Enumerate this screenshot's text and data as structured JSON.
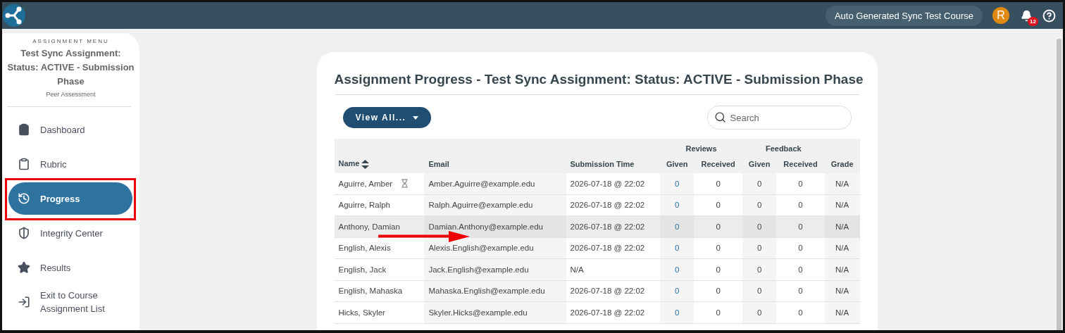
{
  "top_bar": {
    "course": "Auto Generated Sync Test Course",
    "avatar": "R",
    "notifications": "12"
  },
  "sidebar": {
    "caption": "ASSIGNMENT MENU",
    "title": "Test Sync Assignment: Status: ACTIVE - Submission Phase",
    "subtitle": "Peer Assessment",
    "items": [
      {
        "kind": "dashboard",
        "label": "Dashboard",
        "selected": false,
        "outlined": false
      },
      {
        "kind": "rubric",
        "label": "Rubric",
        "selected": false,
        "outlined": false
      },
      {
        "kind": "progress",
        "label": "Progress",
        "selected": true,
        "outlined": true
      },
      {
        "kind": "integrity",
        "label": "Integrity Center",
        "selected": false,
        "outlined": false
      },
      {
        "kind": "results",
        "label": "Results",
        "selected": false,
        "outlined": false
      },
      {
        "kind": "exit",
        "label": "Exit to Course Assignment List",
        "selected": false,
        "outlined": false
      }
    ]
  },
  "card": {
    "title": "Assignment Progress - Test Sync Assignment: Status: ACTIVE - Submission Phase",
    "view_button": "View All...",
    "search": {
      "placeholder": "Search"
    },
    "table": {
      "groups": [
        "Reviews",
        "Feedback"
      ],
      "columns": [
        "Name",
        "Email",
        "Submission Time",
        "Given",
        "Received",
        "Given",
        "Received",
        "Grade"
      ],
      "rows": [
        {
          "pending": true,
          "highlighted": false,
          "pointed": false,
          "cells": [
            "Aguirre, Amber",
            "Amber.Aguirre@example.edu",
            "2026-07-18 @ 22:02",
            "0",
            "0",
            "0",
            "0",
            "N/A"
          ]
        },
        {
          "pending": false,
          "highlighted": false,
          "pointed": false,
          "cells": [
            "Aguirre, Ralph",
            "Ralph.Aguirre@example.edu",
            "2026-07-18 @ 22:02",
            "0",
            "0",
            "0",
            "0",
            "N/A"
          ]
        },
        {
          "pending": false,
          "highlighted": true,
          "pointed": true,
          "cells": [
            "Anthony, Damian",
            "Damian.Anthony@example.edu",
            "2026-07-18 @ 22:02",
            "0",
            "0",
            "0",
            "0",
            "N/A"
          ]
        },
        {
          "pending": false,
          "highlighted": false,
          "pointed": false,
          "cells": [
            "English, Alexis",
            "Alexis.English@example.edu",
            "2026-07-18 @ 22:02",
            "0",
            "0",
            "0",
            "0",
            "N/A"
          ]
        },
        {
          "pending": false,
          "highlighted": false,
          "pointed": false,
          "cells": [
            "English, Jack",
            "Jack.English@example.edu",
            "N/A",
            "0",
            "0",
            "0",
            "0",
            "N/A"
          ]
        },
        {
          "pending": false,
          "highlighted": false,
          "pointed": false,
          "cells": [
            "English, Mahaska",
            "Mahaska.English@example.edu",
            "2026-07-18 @ 22:02",
            "0",
            "0",
            "0",
            "0",
            "N/A"
          ]
        },
        {
          "pending": false,
          "highlighted": false,
          "pointed": false,
          "cells": [
            "Hicks, Skyler",
            "Skyler.Hicks@example.edu",
            "2026-07-18 @ 22:02",
            "0",
            "0",
            "0",
            "0",
            "N/A"
          ]
        }
      ]
    }
  }
}
